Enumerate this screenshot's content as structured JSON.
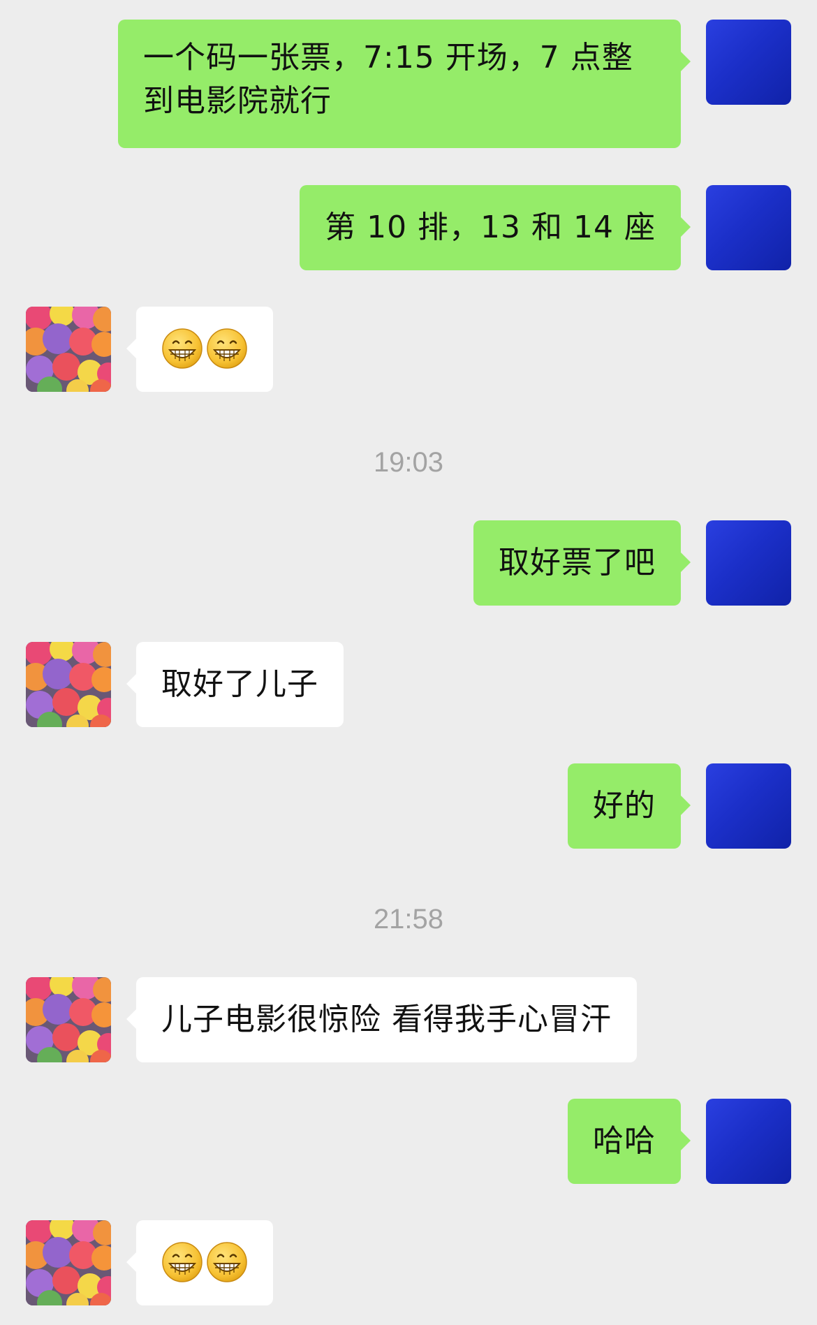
{
  "messages": [
    {
      "side": "me",
      "text": "一个码一张票，7:15 开场，7 点整到电影院就行"
    },
    {
      "side": "me",
      "text": "第 10 排，13 和 14 座"
    },
    {
      "side": "other",
      "emoji": [
        "grinning-face",
        "grinning-face"
      ]
    },
    {
      "timestamp": "19:03"
    },
    {
      "side": "me",
      "text": "取好票了吧"
    },
    {
      "side": "other",
      "text": "取好了儿子"
    },
    {
      "side": "me",
      "text": "好的"
    },
    {
      "timestamp": "21:58"
    },
    {
      "side": "other",
      "text": "儿子电影很惊险 看得我手心冒汗"
    },
    {
      "side": "me",
      "text": "哈哈"
    },
    {
      "side": "other",
      "emoji": [
        "grinning-face",
        "grinning-face"
      ]
    }
  ],
  "colors": {
    "background": "#ededed",
    "my_bubble": "#95ec69",
    "other_bubble": "#ffffff",
    "timestamp": "#a3a3a3"
  }
}
